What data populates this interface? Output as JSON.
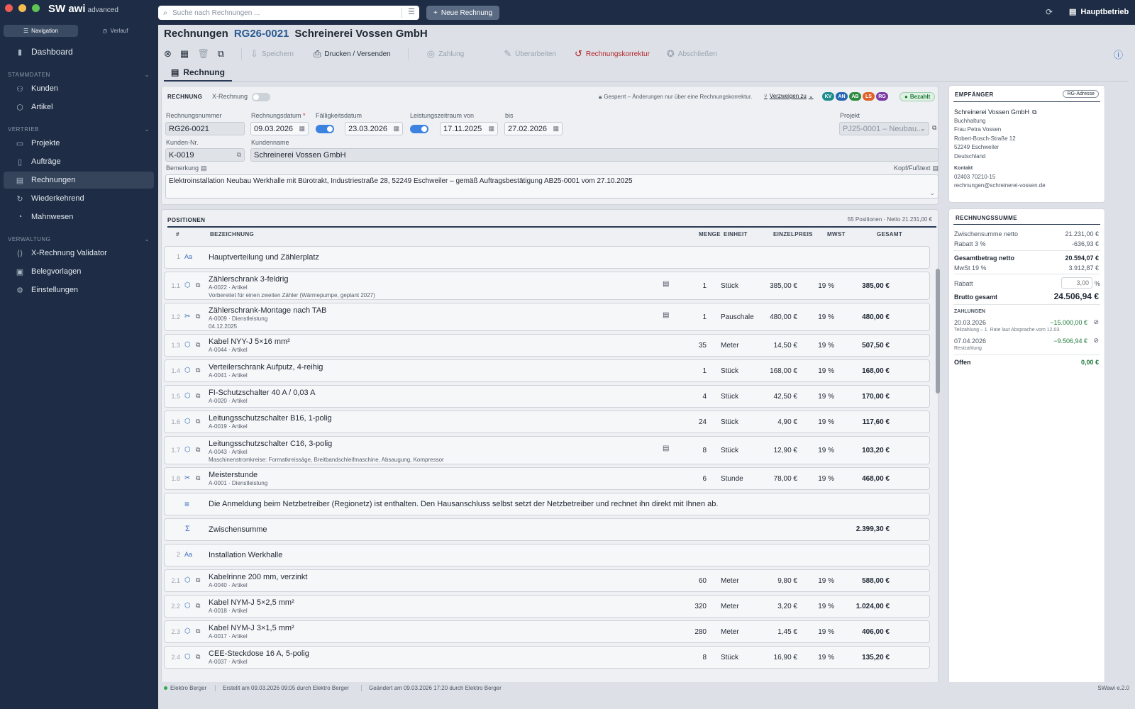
{
  "app": {
    "brand": "SW awi",
    "edition": "advanced",
    "search_placeholder": "Suche nach Rechnungen ...",
    "new_button": "Neue Rechnung",
    "location": "Hauptbetrieb"
  },
  "colors": {
    "topbar": "#1e2d45",
    "accent": "#2b5b93",
    "danger": "#b3262a",
    "success": "#1f7a3a"
  },
  "sidebar": {
    "tabs": [
      "Navigation",
      "Verlauf"
    ],
    "dashboard": "Dashboard",
    "sections": [
      {
        "title": "STAMMDATEN",
        "items": [
          "Kunden",
          "Artikel"
        ]
      },
      {
        "title": "VERTRIEB",
        "items": [
          "Projekte",
          "Aufträge",
          "Rechnungen",
          "Wiederkehrend",
          "Mahnwesen"
        ]
      },
      {
        "title": "VERWALTUNG",
        "items": [
          "X-Rechnung Validator",
          "Belegvorlagen",
          "Einstellungen"
        ]
      }
    ],
    "active": "Rechnungen"
  },
  "page": {
    "crumb": "Rechnungen",
    "number": "RG26-0021",
    "customer": "Schreinerei Vossen GmbH"
  },
  "toolbar": {
    "save": "Speichern",
    "print": "Drucken / Versenden",
    "payment": "Zahlung",
    "edit": "Überarbeiten",
    "correction": "Rechnungskorrektur",
    "close": "Abschließen"
  },
  "tab": "Rechnung",
  "form": {
    "section": "RECHNUNG",
    "xrechnung": "X-Rechnung",
    "locked": "Gesperrt – Änderungen nur über eine Rechnungskorrektur.",
    "branch": "Verzweigen zu",
    "badges": [
      "KV",
      "AN",
      "AB",
      "LS",
      "RG"
    ],
    "paid": "Bezahlt",
    "labels": {
      "number": "Rechnungsnummer",
      "date": "Rechnungsdatum",
      "due": "Fälligkeitsdatum",
      "period_from": "Leistungszeitraum von",
      "period_to": "bis",
      "project": "Projekt",
      "customer_no": "Kunden-Nr.",
      "customer_name": "Kundenname",
      "remark": "Bemerkung",
      "header_footer": "Kopf/Fußtext"
    },
    "values": {
      "number": "RG26-0021",
      "date": "09.03.2026",
      "due": "23.03.2026",
      "period_from": "17.11.2025",
      "period_to": "27.02.2026",
      "project": "PJ25-0001 – Neubau...",
      "customer_no": "K-0019",
      "customer_name": "Schreinerei Vossen GmbH",
      "remark": "Elektroinstallation Neubau Werkhalle mit Bürotrakt, Industriestraße 28, 52249 Eschweiler – gemäß Auftragsbestätigung AB25-0001 vom 27.10.2025"
    }
  },
  "positions": {
    "title": "POSITIONEN",
    "summary": "55 Positionen · Netto 21.231,00 €",
    "headers": {
      "nr": "#",
      "desc": "BEZEICHNUNG",
      "qty": "MENGE",
      "unit": "EINHEIT",
      "price": "EINZELPREIS",
      "vat": "MWST",
      "total": "GESAMT"
    },
    "rows": [
      {
        "kind": "group",
        "nr": "1",
        "icon": "Aa",
        "title": "Hauptverteilung und Zählerplatz"
      },
      {
        "kind": "item",
        "nr": "1.1",
        "type": "artikel",
        "title": "Zählerschrank 3-feldrig",
        "sub": "A-0022 · Artikel",
        "note": "Vorbereitet für einen zweiten Zähler (Wärmepumpe, geplant 2027)",
        "ext": true,
        "qty": "1",
        "unit": "Stück",
        "price": "385,00 €",
        "vat": "19 %",
        "total": "385,00 €"
      },
      {
        "kind": "item",
        "nr": "1.2",
        "type": "dienst",
        "title": "Zählerschrank-Montage nach TAB",
        "sub": "A-0009 · Dienstleistung",
        "note": "04.12.2025",
        "ext": true,
        "qty": "1",
        "unit": "Pauschale",
        "price": "480,00 €",
        "vat": "19 %",
        "total": "480,00 €"
      },
      {
        "kind": "item",
        "nr": "1.3",
        "type": "artikel",
        "title": "Kabel NYY-J 5×16 mm²",
        "sub": "A-0044 · Artikel",
        "qty": "35",
        "unit": "Meter",
        "price": "14,50 €",
        "vat": "19 %",
        "total": "507,50 €"
      },
      {
        "kind": "item",
        "nr": "1.4",
        "type": "artikel",
        "title": "Verteilerschrank Aufputz, 4-reihig",
        "sub": "A-0041 · Artikel",
        "qty": "1",
        "unit": "Stück",
        "price": "168,00 €",
        "vat": "19 %",
        "total": "168,00 €"
      },
      {
        "kind": "item",
        "nr": "1.5",
        "type": "artikel",
        "title": "FI-Schutzschalter 40 A / 0,03 A",
        "sub": "A-0020 · Artikel",
        "qty": "4",
        "unit": "Stück",
        "price": "42,50 €",
        "vat": "19 %",
        "total": "170,00 €"
      },
      {
        "kind": "item",
        "nr": "1.6",
        "type": "artikel",
        "title": "Leitungsschutzschalter B16, 1-polig",
        "sub": "A-0019 · Artikel",
        "qty": "24",
        "unit": "Stück",
        "price": "4,90 €",
        "vat": "19 %",
        "total": "117,60 €"
      },
      {
        "kind": "item",
        "nr": "1.7",
        "type": "artikel",
        "title": "Leitungsschutzschalter C16, 3-polig",
        "sub": "A-0043 · Artikel",
        "note": "Maschinenstromkreise: Formatkreissäge, Breitbandschleifmaschine, Absaugung, Kompressor",
        "ext": true,
        "qty": "8",
        "unit": "Stück",
        "price": "12,90 €",
        "vat": "19 %",
        "total": "103,20 €"
      },
      {
        "kind": "item",
        "nr": "1.8",
        "type": "dienst",
        "title": "Meisterstunde",
        "sub": "A-0001 · Dienstleistung",
        "qty": "6",
        "unit": "Stunde",
        "price": "78,00 €",
        "vat": "19 %",
        "total": "468,00 €"
      },
      {
        "kind": "text",
        "icon": "≡",
        "title": "Die Anmeldung beim Netzbetreiber (Regionetz) ist enthalten. Den Hausanschluss selbst setzt der Netzbetreiber und rechnet ihn direkt mit Ihnen ab."
      },
      {
        "kind": "sum",
        "icon": "Σ",
        "title": "Zwischensumme",
        "total": "2.399,30 €"
      },
      {
        "kind": "group",
        "nr": "2",
        "icon": "Aa",
        "title": "Installation Werkhalle"
      },
      {
        "kind": "item",
        "nr": "2.1",
        "type": "artikel",
        "title": "Kabelrinne 200 mm, verzinkt",
        "sub": "A-0040 · Artikel",
        "qty": "60",
        "unit": "Meter",
        "price": "9,80 €",
        "vat": "19 %",
        "total": "588,00 €"
      },
      {
        "kind": "item",
        "nr": "2.2",
        "type": "artikel",
        "title": "Kabel NYM-J 5×2,5 mm²",
        "sub": "A-0018 · Artikel",
        "qty": "320",
        "unit": "Meter",
        "price": "3,20 €",
        "vat": "19 %",
        "total": "1.024,00 €"
      },
      {
        "kind": "item",
        "nr": "2.3",
        "type": "artikel",
        "title": "Kabel NYM-J 3×1,5 mm²",
        "sub": "A-0017 · Artikel",
        "qty": "280",
        "unit": "Meter",
        "price": "1,45 €",
        "vat": "19 %",
        "total": "406,00 €"
      },
      {
        "kind": "item",
        "nr": "2.4",
        "type": "artikel",
        "title": "CEE-Steckdose 16 A, 5-polig",
        "sub": "A-0037 · Artikel",
        "qty": "8",
        "unit": "Stück",
        "price": "16,90 €",
        "vat": "19 %",
        "total": "135,20 €"
      }
    ]
  },
  "recipient": {
    "title": "EMPFÄNGER",
    "button": "RG-Adresse",
    "lines": [
      "Schreinerei Vossen GmbH",
      "Buchhaltung",
      "Frau Petra Vossen",
      "Robert-Bosch-Straße 12",
      "52249 Eschweiler",
      "Deutschland"
    ],
    "contact_label": "Kontakt",
    "phone": "02403 70210-15",
    "email": "rechnungen@schreinerei-vossen.de"
  },
  "totals": {
    "title": "RECHNUNGSSUMME",
    "subtotal_label": "Zwischensumme netto",
    "subtotal": "21.231,00 €",
    "discount_label": "Rabatt 3 %",
    "discount": "-636,93 €",
    "net_label": "Gesamtbetrag netto",
    "net": "20.594,07 €",
    "vat_label": "MwSt 19 %",
    "vat": "3.912,87 €",
    "rabatt_label": "Rabatt",
    "rabatt_placeholder": "3,00",
    "percent": "%",
    "gross_label": "Brutto gesamt",
    "gross": "24.506,94 €",
    "payments_title": "ZAHLUNGEN",
    "payments": [
      {
        "date": "20.03.2026",
        "amount": "−15.000,00 €",
        "note": "Teilzahlung – 1. Rate laut Absprache vom 12.03."
      },
      {
        "date": "07.04.2026",
        "amount": "−9.506,94 €",
        "note": "Restzahlung"
      }
    ],
    "open_label": "Offen",
    "open": "0,00 €"
  },
  "status": {
    "user": "Elektro Berger",
    "created": "Erstellt am 09.03.2026 09:05 durch Elektro Berger",
    "changed": "Geändert am 09.03.2026 17:20 durch Elektro Berger",
    "version": "SWawi e.2.0"
  }
}
